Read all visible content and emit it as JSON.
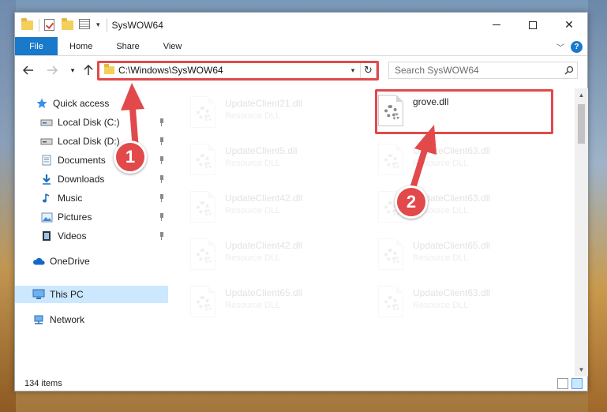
{
  "window": {
    "title": "SysWOW64",
    "controls": {
      "minimize": "minimize",
      "maximize": "maximize",
      "close": "✕"
    }
  },
  "ribbon": {
    "tabs": [
      "File",
      "Home",
      "Share",
      "View"
    ],
    "help_label": "?"
  },
  "address": {
    "path": "C:\\Windows\\SysWOW64",
    "search_placeholder": "Search SysWOW64"
  },
  "sidebar": {
    "items": [
      {
        "label": "Quick access",
        "icon": "star-icon",
        "pinned": false
      },
      {
        "label": "Local Disk (C:)",
        "icon": "drive-icon",
        "pinned": true
      },
      {
        "label": "Local Disk (D:)",
        "icon": "drive-icon",
        "pinned": true
      },
      {
        "label": "Documents",
        "icon": "documents-icon",
        "pinned": true
      },
      {
        "label": "Downloads",
        "icon": "download-icon",
        "pinned": true
      },
      {
        "label": "Music",
        "icon": "music-icon",
        "pinned": true
      },
      {
        "label": "Pictures",
        "icon": "pictures-icon",
        "pinned": true
      },
      {
        "label": "Videos",
        "icon": "videos-icon",
        "pinned": true
      },
      {
        "label": "OneDrive",
        "icon": "cloud-icon",
        "pinned": false
      },
      {
        "label": "This PC",
        "icon": "pc-icon",
        "pinned": false,
        "selected": true
      },
      {
        "label": "Network",
        "icon": "network-icon",
        "pinned": false
      }
    ]
  },
  "files": {
    "left_column": [
      {
        "name": "UpdateClient21.dll",
        "type": "Resource DLL"
      },
      {
        "name": "UpdateClient5.dll",
        "type": "Resource DLL"
      },
      {
        "name": "UpdateClient42.dll",
        "type": "Resource DLL"
      },
      {
        "name": "UpdateClient42.dll",
        "type": "Resource DLL"
      },
      {
        "name": "UpdateClient65.dll",
        "type": "Resource DLL"
      }
    ],
    "right_column": [
      {
        "name": "grove.dll",
        "type": "",
        "highlighted": true
      },
      {
        "name": "UpdateClient63.dll",
        "type": "Resource DLL"
      },
      {
        "name": "UpdateClient63.dll",
        "type": "Resource DLL"
      },
      {
        "name": "UpdateClient65.dll",
        "type": "Resource DLL"
      },
      {
        "name": "UpdateClient63.dll",
        "type": "Resource DLL"
      }
    ]
  },
  "status": {
    "item_count": "134 items"
  },
  "annotations": {
    "step1": "1",
    "step2": "2",
    "color": "#e1494b"
  },
  "colors": {
    "accent": "#1979ca",
    "selection": "#cce8ff",
    "highlight": "#e1494b"
  }
}
